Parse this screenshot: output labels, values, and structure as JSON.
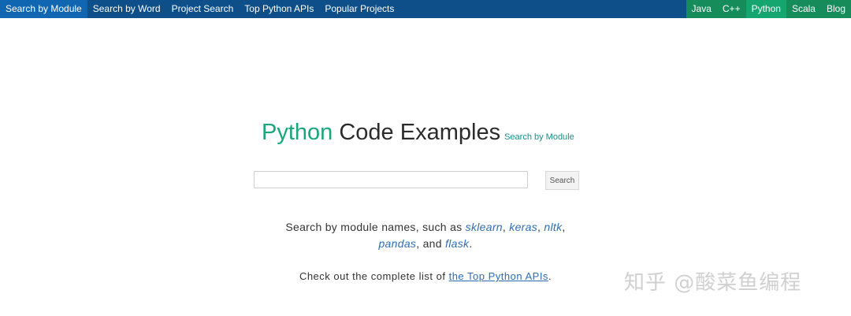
{
  "nav": {
    "left": [
      {
        "label": "Search by Module",
        "active": true
      },
      {
        "label": "Search by Word",
        "active": false
      },
      {
        "label": "Project Search",
        "active": false
      },
      {
        "label": "Top Python APIs",
        "active": false
      },
      {
        "label": "Popular Projects",
        "active": false
      }
    ],
    "right": [
      {
        "label": "Java",
        "active": false
      },
      {
        "label": "C++",
        "active": false
      },
      {
        "label": "Python",
        "active": true
      },
      {
        "label": "Scala",
        "active": false
      },
      {
        "label": "Blog",
        "active": false
      }
    ]
  },
  "header": {
    "title_accent": "Python",
    "title_rest": " Code Examples",
    "subtitle_link": "Search by Module"
  },
  "search": {
    "value": "",
    "placeholder": "",
    "button_label": "Search"
  },
  "description": {
    "line1_prefix": "Search by module names, such as ",
    "modules": [
      "sklearn",
      "keras",
      "nltk",
      "pandas",
      "flask"
    ],
    "sep1": ", ",
    "sep2": ", ",
    "sep3": ",",
    "sep4": ", and ",
    "end": ".",
    "line3_prefix": "Check out the complete list of ",
    "line3_link": "the Top Python APIs",
    "line3_end": "."
  },
  "watermark": "知乎 @酸菜鱼编程",
  "colors": {
    "nav_bg": "#0e4f8a",
    "nav_active": "#1166b2",
    "lang_bg": "#168c5a",
    "lang_active": "#15a56f",
    "accent": "#18a67a",
    "link": "#2e6db5"
  }
}
